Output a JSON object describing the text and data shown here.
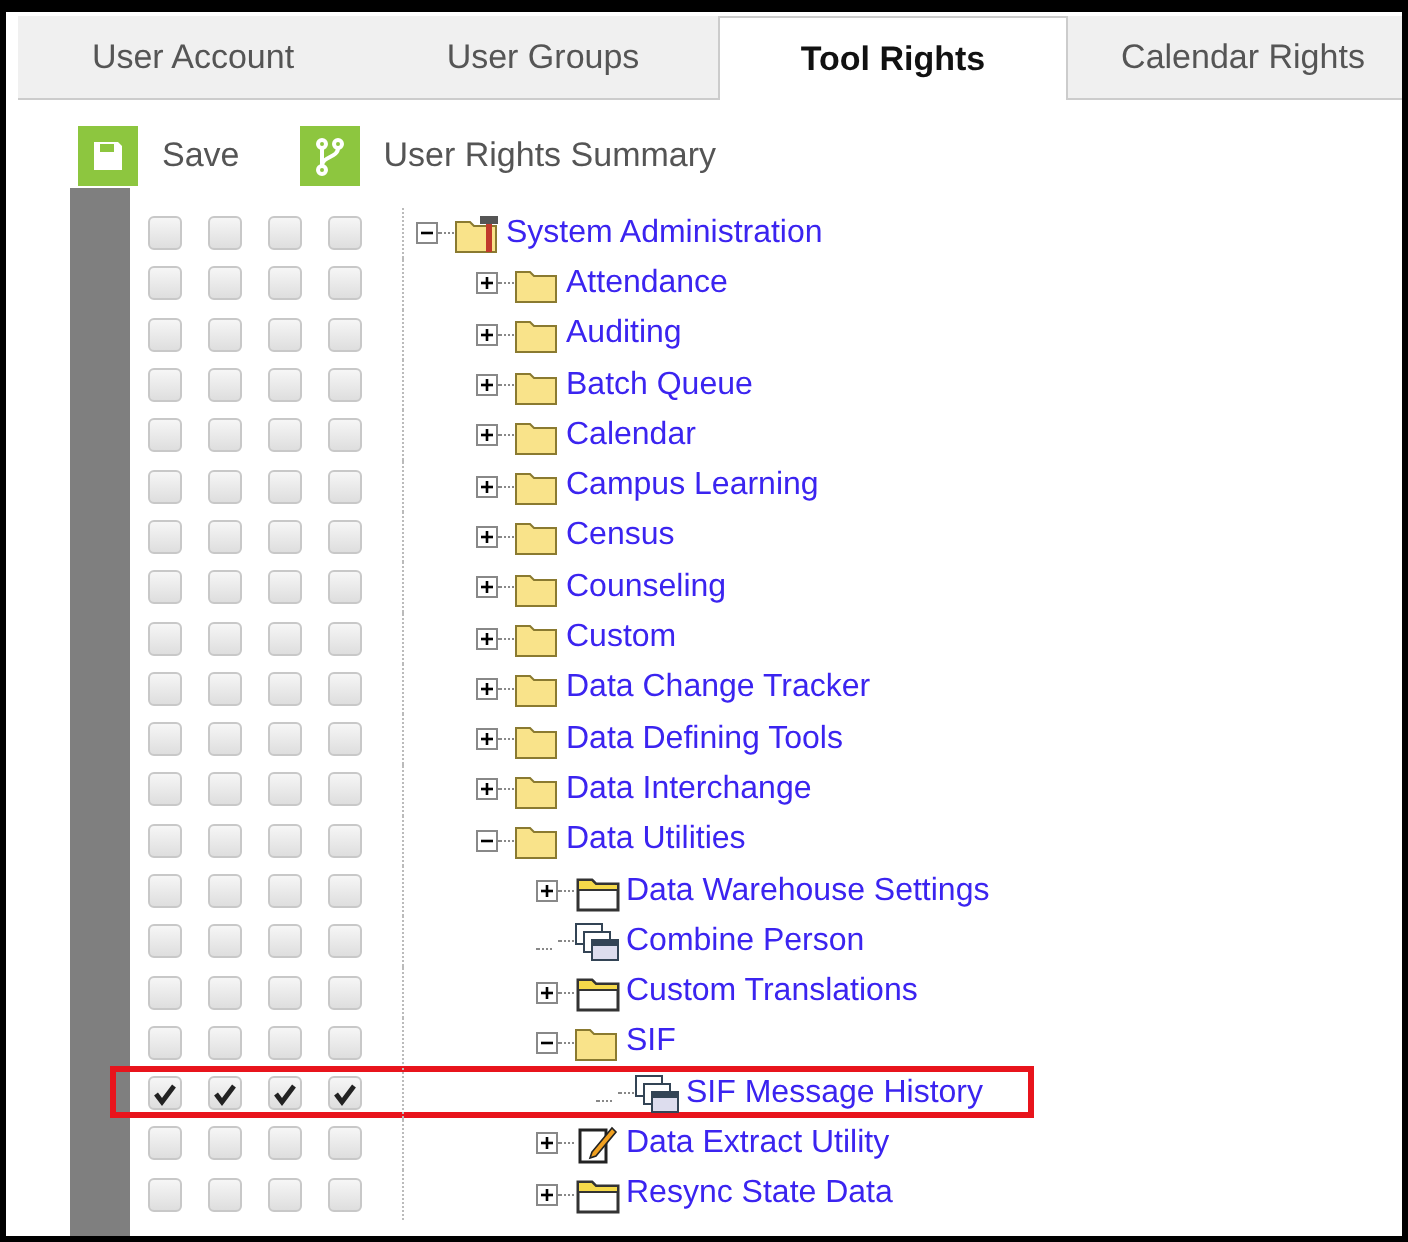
{
  "tabs": [
    {
      "label": "User Account",
      "selected": false
    },
    {
      "label": "User Groups",
      "selected": false
    },
    {
      "label": "Tool Rights",
      "selected": true
    },
    {
      "label": "Calendar Rights",
      "selected": false
    }
  ],
  "toolbar": [
    {
      "label": "Save",
      "kind": "save"
    },
    {
      "label": "User Rights Summary",
      "kind": "summary"
    }
  ],
  "tree": [
    {
      "label": "System Administration",
      "kind": "tool",
      "expanded": true,
      "rights": [
        false,
        false,
        false,
        false
      ],
      "children": [
        {
          "label": "Attendance",
          "kind": "folder",
          "expanded": false,
          "rights": [
            false,
            false,
            false,
            false
          ]
        },
        {
          "label": "Auditing",
          "kind": "folder",
          "expanded": false,
          "rights": [
            false,
            false,
            false,
            false
          ]
        },
        {
          "label": "Batch Queue",
          "kind": "folder",
          "expanded": false,
          "rights": [
            false,
            false,
            false,
            false
          ]
        },
        {
          "label": "Calendar",
          "kind": "folder",
          "expanded": false,
          "rights": [
            false,
            false,
            false,
            false
          ]
        },
        {
          "label": "Campus Learning",
          "kind": "folder",
          "expanded": false,
          "rights": [
            false,
            false,
            false,
            false
          ]
        },
        {
          "label": "Census",
          "kind": "folder",
          "expanded": false,
          "rights": [
            false,
            false,
            false,
            false
          ]
        },
        {
          "label": "Counseling",
          "kind": "folder",
          "expanded": false,
          "rights": [
            false,
            false,
            false,
            false
          ]
        },
        {
          "label": "Custom",
          "kind": "folder",
          "expanded": false,
          "rights": [
            false,
            false,
            false,
            false
          ]
        },
        {
          "label": "Data Change Tracker",
          "kind": "folder",
          "expanded": false,
          "rights": [
            false,
            false,
            false,
            false
          ]
        },
        {
          "label": "Data Defining Tools",
          "kind": "folder",
          "expanded": false,
          "rights": [
            false,
            false,
            false,
            false
          ]
        },
        {
          "label": "Data Interchange",
          "kind": "folder",
          "expanded": false,
          "rights": [
            false,
            false,
            false,
            false
          ]
        },
        {
          "label": "Data Utilities",
          "kind": "folder",
          "expanded": true,
          "rights": [
            false,
            false,
            false,
            false
          ],
          "children": [
            {
              "label": "Data Warehouse Settings",
              "kind": "open-folder",
              "expanded": false,
              "rights": [
                false,
                false,
                false,
                false
              ]
            },
            {
              "label": "Combine Person",
              "kind": "page",
              "rights": [
                false,
                false,
                false,
                false
              ]
            },
            {
              "label": "Custom Translations",
              "kind": "open-folder",
              "expanded": false,
              "rights": [
                false,
                false,
                false,
                false
              ]
            },
            {
              "label": "SIF",
              "kind": "folder",
              "expanded": true,
              "rights": [
                false,
                false,
                false,
                false
              ],
              "children": [
                {
                  "label": "SIF Message History",
                  "kind": "page",
                  "highlighted": true,
                  "rights": [
                    true,
                    true,
                    true,
                    true
                  ]
                }
              ]
            },
            {
              "label": "Data Extract Utility",
              "kind": "document",
              "expanded": false,
              "rights": [
                false,
                false,
                false,
                false
              ]
            },
            {
              "label": "Resync State Data",
              "kind": "open-folder",
              "expanded": false,
              "rights": [
                false,
                false,
                false,
                false
              ]
            }
          ]
        }
      ]
    }
  ]
}
